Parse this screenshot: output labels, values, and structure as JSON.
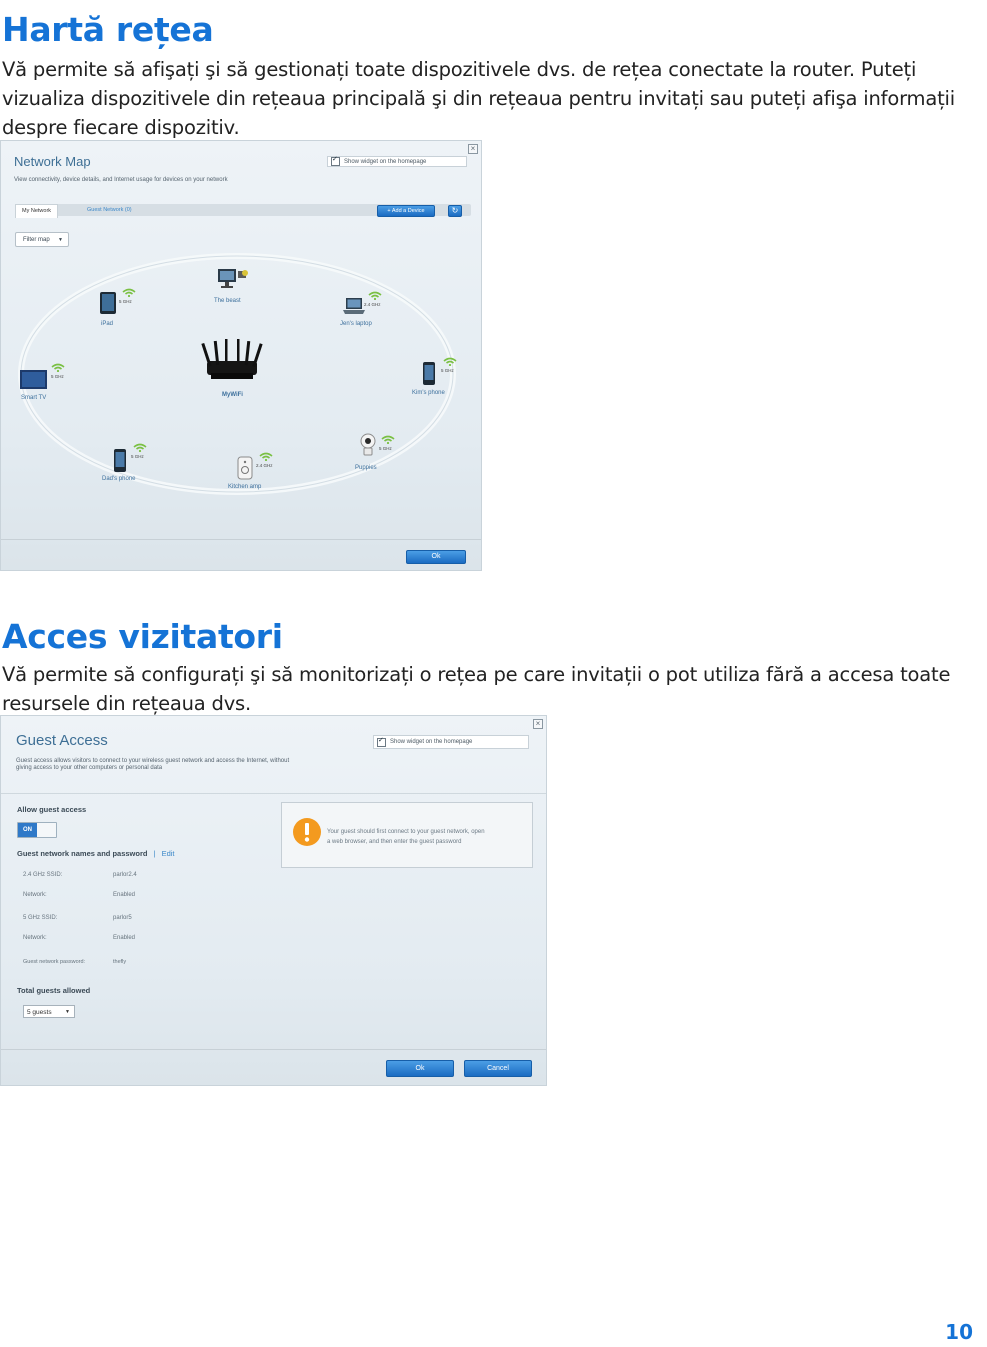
{
  "section1": {
    "heading": "Hartă rețea",
    "lines": [
      "Vă permite să afişați şi să gestionați toate dispozitivele dvs. de rețea conectate la router. Puteți",
      "vizualiza dispozitivele din rețeaua principală şi din rețeaua pentru invitați sau puteți afişa informații",
      "despre fiecare dispozitiv."
    ]
  },
  "network_map": {
    "title": "Network Map",
    "subtitle": "View connectivity, device details, and Internet usage for devices on your network",
    "widget_checkbox": "Show widget on the homepage",
    "tabs": [
      "My Network",
      "Guest Network (0)"
    ],
    "add_device_button": "+ Add a Device",
    "refresh_icon": "refresh-icon",
    "filter_label": "Filter map",
    "router_label": "MyWiFi",
    "devices": [
      {
        "label": "iPad",
        "band": "5 GHz",
        "icon": "tablet-icon"
      },
      {
        "label": "The beast",
        "band": "",
        "icon": "desktop-icon"
      },
      {
        "label": "Jen's laptop",
        "band": "2.4 GHz",
        "icon": "laptop-icon"
      },
      {
        "label": "Smart TV",
        "band": "5 GHz",
        "icon": "tv-icon"
      },
      {
        "label": "Kim's phone",
        "band": "5 GHz",
        "icon": "phone-icon"
      },
      {
        "label": "Dad's phone",
        "band": "5 GHz",
        "icon": "phone-icon"
      },
      {
        "label": "Kitchen amp",
        "band": "2.4 GHz",
        "icon": "speaker-icon"
      },
      {
        "label": "Puppies",
        "band": "5 GHz",
        "icon": "camera-icon"
      }
    ],
    "ok_button": "Ok"
  },
  "section2": {
    "heading": "Acces vizitatori",
    "lines": [
      "Vă permite să configurați şi să monitorizați o rețea pe care invitații o pot utiliza fără a accesa toate",
      "resursele din rețeaua dvs."
    ]
  },
  "guest_access": {
    "title": "Guest Access",
    "subtitle_lines": [
      "Guest access allows visitors to connect to your wireless guest network and access the Internet, without",
      "giving access to your other computers or personal data"
    ],
    "widget_checkbox": "Show widget on the homepage",
    "allow_label": "Allow guest access",
    "toggle_state": "ON",
    "names_label": "Guest network names and password",
    "separator": "|",
    "edit_link": "Edit",
    "rows": [
      {
        "key": "2.4 GHz SSID:",
        "value": "parlor2.4"
      },
      {
        "key": "Network:",
        "value": "Enabled"
      },
      {
        "key": "5 GHz SSID:",
        "value": "parlor5"
      },
      {
        "key": "Network:",
        "value": "Enabled"
      },
      {
        "key": "Guest network password:",
        "value": "thefly"
      }
    ],
    "alert_lines": [
      "Your guest should first connect to your guest network, open",
      "a web browser, and then enter the guest password"
    ],
    "total_label": "Total guests allowed",
    "total_select": "5 guests",
    "ok_button": "Ok",
    "cancel_button": "Cancel"
  },
  "page_number": "10"
}
